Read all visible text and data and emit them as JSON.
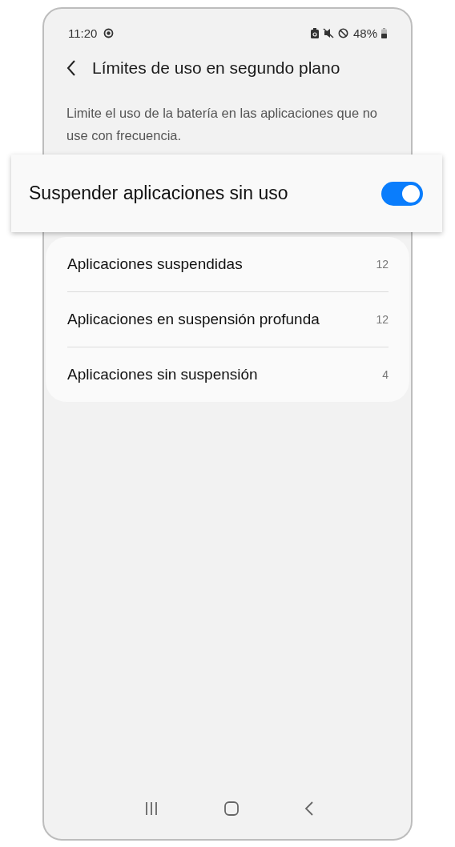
{
  "status_bar": {
    "time": "11:20",
    "battery": "48%"
  },
  "header": {
    "title": "Límites de uso en segundo plano"
  },
  "description": "Limite el uso de la batería en las aplicaciones que no use con frecuencia.",
  "main_toggle": {
    "label": "Suspender aplicaciones sin uso",
    "on": true
  },
  "items": [
    {
      "label": "Aplicaciones suspendidas",
      "count": "12"
    },
    {
      "label": "Aplicaciones en suspensión profunda",
      "count": "12"
    },
    {
      "label": "Aplicaciones sin suspensión",
      "count": "4"
    }
  ]
}
